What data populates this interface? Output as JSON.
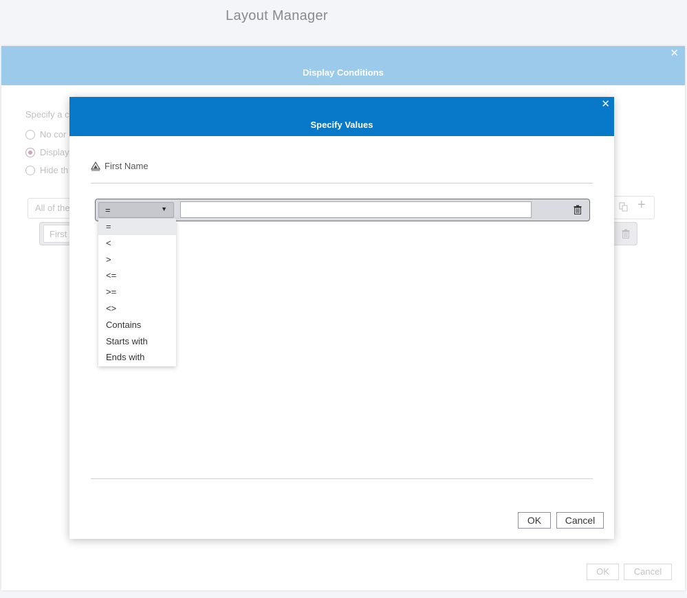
{
  "layout_manager": {
    "title": "Layout Manager"
  },
  "display_conditions": {
    "title": "Display Conditions",
    "close_glyph": "✕",
    "specify_label": "Specify a c",
    "radio_options": [
      {
        "label": "No cor",
        "checked": false
      },
      {
        "label": "Display",
        "checked": true
      },
      {
        "label": "Hide th",
        "checked": false
      }
    ],
    "match_select_value": "All of the",
    "inner_field_value": "First",
    "ok_label": "OK",
    "cancel_label": "Cancel",
    "icons": {
      "copy": "copy-icon",
      "add": "plus-icon",
      "delete": "trash-icon"
    }
  },
  "specify_values": {
    "title": "Specify Values",
    "close_glyph": "✕",
    "field_name": "First Name",
    "field_icon": "data-item-icon",
    "operator_selected": "=",
    "value_input": "",
    "operators": [
      "=",
      "<",
      ">",
      "<=",
      ">=",
      "<>",
      "Contains",
      "Starts with",
      "Ends with"
    ],
    "ok_label": "OK",
    "cancel_label": "Cancel",
    "colors": {
      "header": "#0878c9",
      "header_dim": "#9ccaeb"
    }
  }
}
